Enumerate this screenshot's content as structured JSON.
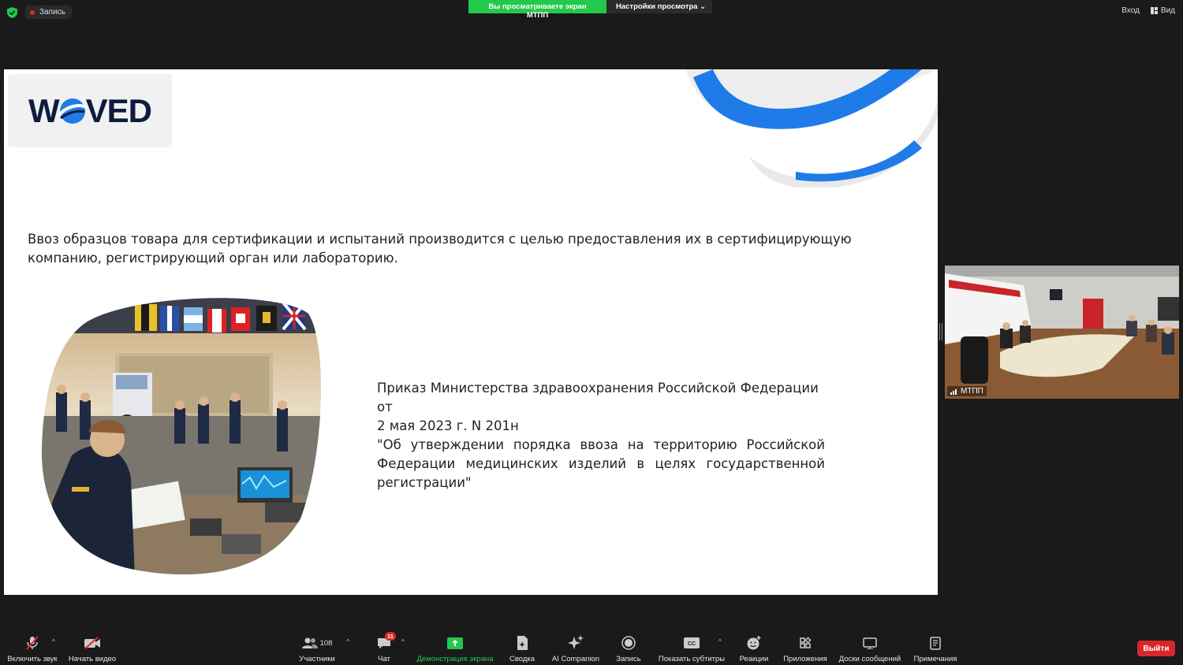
{
  "topbar": {
    "recording_label": "Запись",
    "share_banner": "Вы просматриваете экран МТПП",
    "view_settings": "Настройки просмотра",
    "signin": "Вход",
    "view": "Вид"
  },
  "slide": {
    "logo_text_left": "W",
    "logo_text_right": "VED",
    "main_text": "Ввоз образцов товара для сертификации и испытаний производится с целью предоставления их в сертифицирующую компанию, регистрирующий орган или лабораторию.",
    "order_line1": "Приказ Министерства здравоохранения Российской Федерации от",
    "order_line2": "2 мая 2023 г. N 201н",
    "order_quote": "\"Об утверждении порядка ввоза на территорию Российской Федерации медицинских изделий в целях государственной регистрации\""
  },
  "video": {
    "participant_name": "МТПП"
  },
  "toolbar": {
    "unmute": "Включить звук",
    "start_video": "Начать видео",
    "participants": "Участники",
    "participants_count": "108",
    "chat": "Чат",
    "chat_badge": "11",
    "share_screen": "Демонстрация экрана",
    "summary": "Сводка",
    "ai_companion": "AI Companion",
    "record": "Запись",
    "captions": "Показать субтитры",
    "reactions": "Реакции",
    "apps": "Приложения",
    "whiteboards": "Доски сообщений",
    "notes": "Примечания",
    "leave": "Выйти"
  },
  "colors": {
    "share_green": "#23c94a",
    "leave_red": "#d8262b",
    "brand_blue": "#1e7be8",
    "brand_navy": "#0f1c3f"
  }
}
